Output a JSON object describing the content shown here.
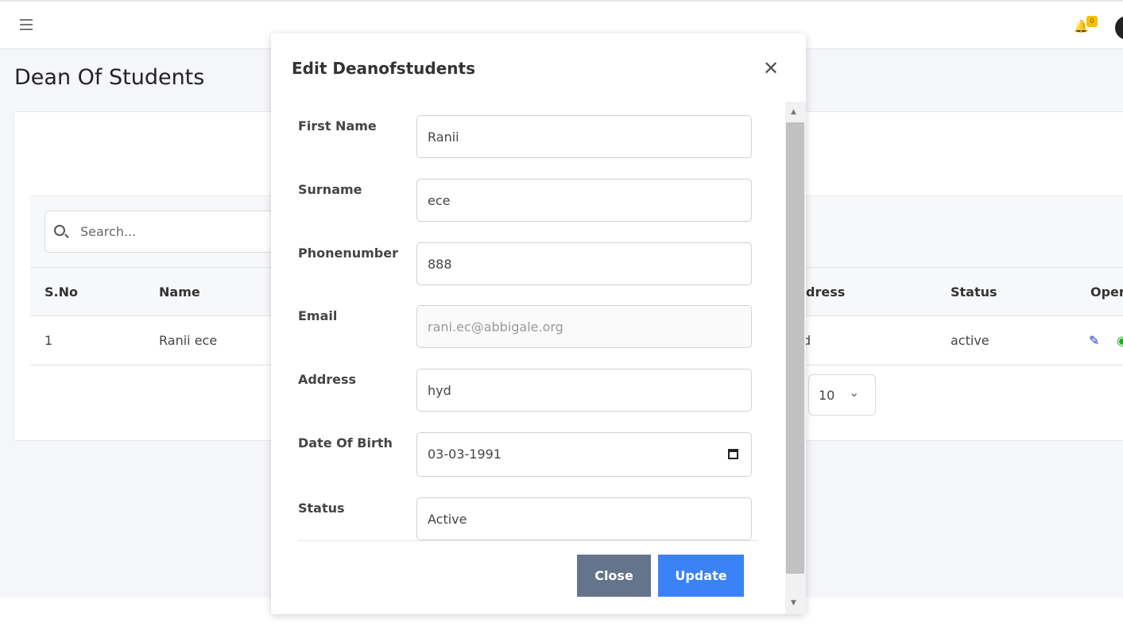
{
  "header": {
    "notification_count": "0"
  },
  "page": {
    "title": "Dean Of Students"
  },
  "search": {
    "placeholder": "Search..."
  },
  "table": {
    "columns": [
      "S.No",
      "Name",
      "Address",
      "Status",
      "Operations"
    ],
    "visible_columns": [
      "S.No",
      "Name",
      "dress",
      "Status",
      "Oper"
    ],
    "rows": [
      {
        "sno": "1",
        "name": "Ranii ece",
        "address": "d",
        "status": "active"
      }
    ]
  },
  "pagination": {
    "page_size": "10"
  },
  "modal": {
    "title": "Edit Deanofstudents",
    "fields": [
      {
        "label": "First Name",
        "value": "Ranii"
      },
      {
        "label": "Surname",
        "value": "ece"
      },
      {
        "label": "Phonenumber",
        "value": "888"
      },
      {
        "label": "Email",
        "value": "rani.ec@abbigale.org"
      },
      {
        "label": "Address",
        "value": "hyd"
      },
      {
        "label": "Date Of Birth",
        "value": "03-03-1991"
      },
      {
        "label": "Status",
        "value": "Active"
      }
    ],
    "close_label": "Close",
    "update_label": "Update"
  },
  "colors": {
    "close_button": "#64748b",
    "update_button": "#3b82f6",
    "edit_icon": "#2233bb",
    "badge": "#f5c000"
  }
}
